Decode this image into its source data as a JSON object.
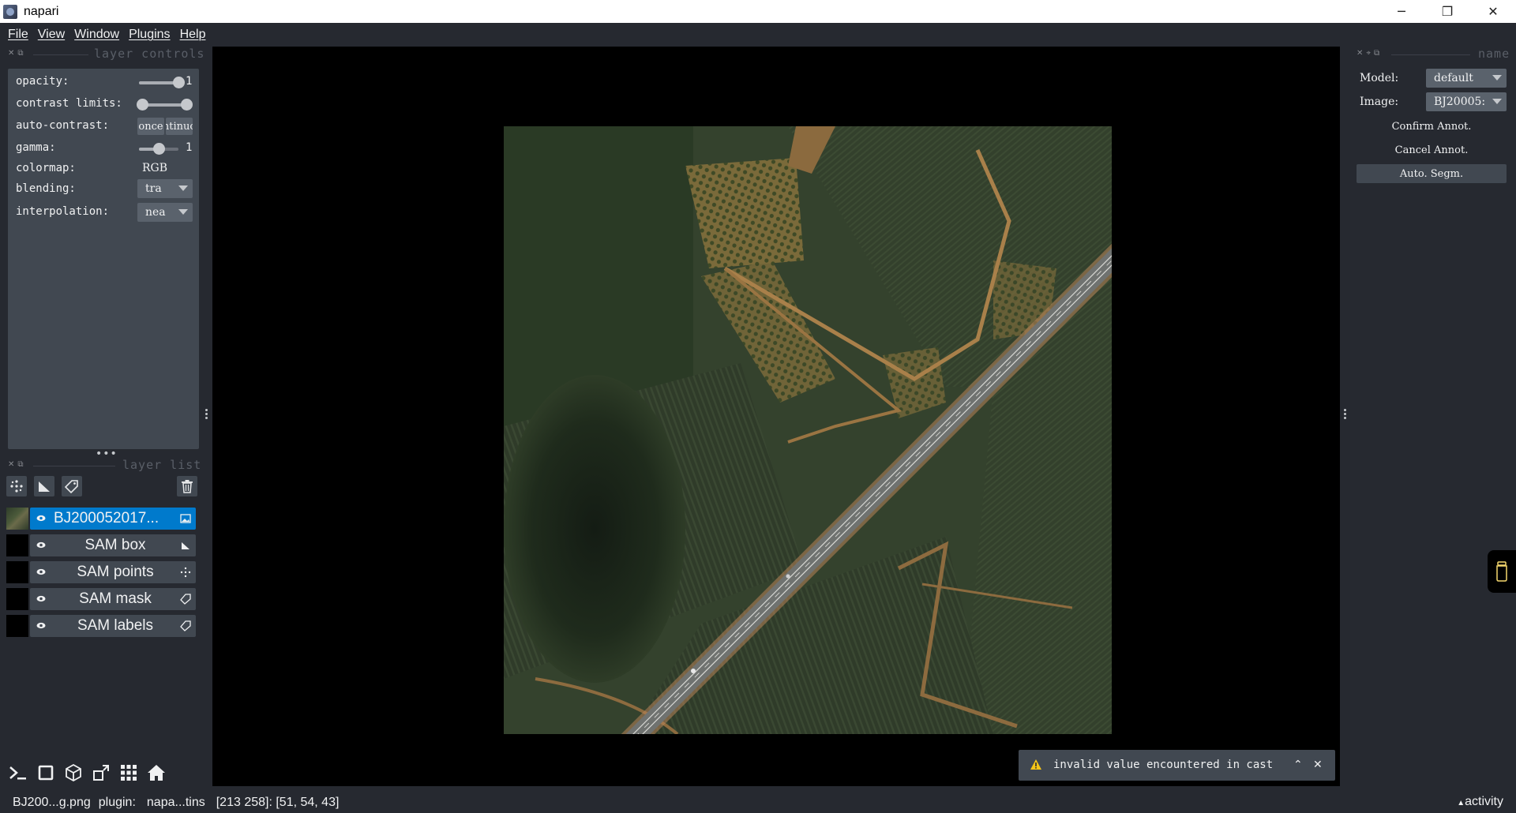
{
  "window": {
    "title": "napari",
    "minimize": "─",
    "maximize": "❐",
    "close": "✕"
  },
  "menu": [
    "File",
    "View",
    "Window",
    "Plugins",
    "Help"
  ],
  "layer_controls": {
    "title": "layer controls",
    "opacity_label": "opacity:",
    "opacity_value": "1",
    "opacity_level": 1.0,
    "contrast_label": "contrast limits:",
    "contrast_range": [
      0.0,
      1.0
    ],
    "auto_contrast_label": "auto-contrast:",
    "auto_once": "once",
    "auto_continuous": "continuous",
    "gamma_label": "gamma:",
    "gamma_value": "1",
    "gamma_level": 0.5,
    "colormap_label": "colormap:",
    "colormap_value": "RGB",
    "blending_label": "blending:",
    "blending_value": "tra",
    "interpolation_label": "interpolation:",
    "interpolation_value": "nea"
  },
  "layer_list": {
    "title": "layer list",
    "layers": [
      {
        "name": "BJ200052017...",
        "selected": true,
        "type": "image"
      },
      {
        "name": "SAM box",
        "selected": false,
        "type": "shapes"
      },
      {
        "name": "SAM points",
        "selected": false,
        "type": "points"
      },
      {
        "name": "SAM mask",
        "selected": false,
        "type": "labels"
      },
      {
        "name": "SAM labels",
        "selected": false,
        "type": "labels"
      }
    ]
  },
  "right_dock": {
    "title": "name",
    "model_label": "Model:",
    "model_value": "default",
    "image_label": "Image:",
    "image_value": "BJ20005:",
    "confirm_label": "Confirm Annot.",
    "cancel_label": "Cancel Annot.",
    "auto_label": "Auto. Segm."
  },
  "notification": {
    "message": "invalid value encountered in cast"
  },
  "status": {
    "file": "BJ200...g.png",
    "plugin_label": "plugin:",
    "plugin_value": "napa...tins",
    "coords": "[213 258]: [51, 54, 43]",
    "activity": "activity"
  },
  "colors": {
    "background": "#262930",
    "panel": "#414851",
    "accent": "#007acc",
    "text": "#f0f1f2"
  }
}
